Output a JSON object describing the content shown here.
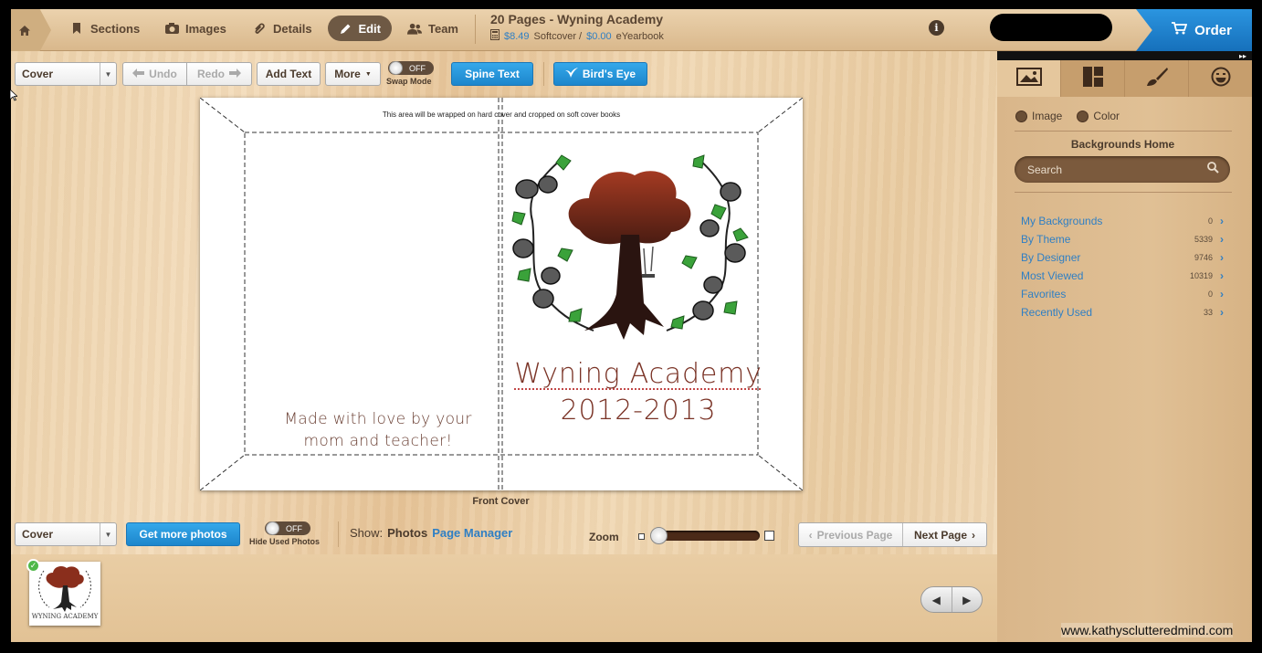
{
  "nav": {
    "items": [
      {
        "label": "Sections",
        "icon": "bookmark-icon"
      },
      {
        "label": "Images",
        "icon": "camera-icon"
      },
      {
        "label": "Details",
        "icon": "paperclip-icon"
      },
      {
        "label": "Edit",
        "icon": "pencil-icon",
        "active": true
      },
      {
        "label": "Team",
        "icon": "people-icon"
      }
    ],
    "project_title": "20 Pages - Wyning Academy",
    "price_softcover": "$8.49",
    "price_softcover_label": "Softcover /",
    "price_eyearbook": "$0.00",
    "price_eyearbook_label": "eYearbook",
    "info": "i",
    "order": "Order"
  },
  "toolbar": {
    "page_select": "Cover",
    "undo": "Undo",
    "redo": "Redo",
    "add_text": "Add Text",
    "more": "More",
    "swap_toggle": "OFF",
    "swap_label": "Swap Mode",
    "spine_text": "Spine Text",
    "birds_eye": "Bird's Eye"
  },
  "page": {
    "wrap_note": "This area will be wrapped on hard cover and cropped on soft cover books",
    "left_line1": "Made with love by your",
    "left_line2": "mom and teacher!",
    "title_line1": "Wyning Academy",
    "title_line2": "2012-2013",
    "caption": "Front Cover"
  },
  "bottom": {
    "page_select": "Cover",
    "get_photos": "Get more photos",
    "hide_toggle": "OFF",
    "hide_label": "Hide Used Photos",
    "show_label": "Show:",
    "show_photos": "Photos",
    "page_manager": "Page Manager",
    "zoom": "Zoom",
    "prev": "Previous Page",
    "next": "Next Page"
  },
  "thumbnail": {
    "caption": "WYNING ACADEMY"
  },
  "watermark": "www.kathysclutteredmind.com",
  "panel": {
    "radio_image": "Image",
    "radio_color": "Color",
    "heading": "Backgrounds Home",
    "search_placeholder": "Search",
    "items": [
      {
        "label": "My Backgrounds",
        "count": "0"
      },
      {
        "label": "By Theme",
        "count": "5339"
      },
      {
        "label": "By Designer",
        "count": "9746"
      },
      {
        "label": "Most Viewed",
        "count": "10319"
      },
      {
        "label": "Favorites",
        "count": "0"
      },
      {
        "label": "Recently Used",
        "count": "33"
      }
    ]
  },
  "colors": {
    "accent_blue": "#1d86cc",
    "brown_text": "#4a3a2c",
    "active_nav": "#6e5944"
  }
}
